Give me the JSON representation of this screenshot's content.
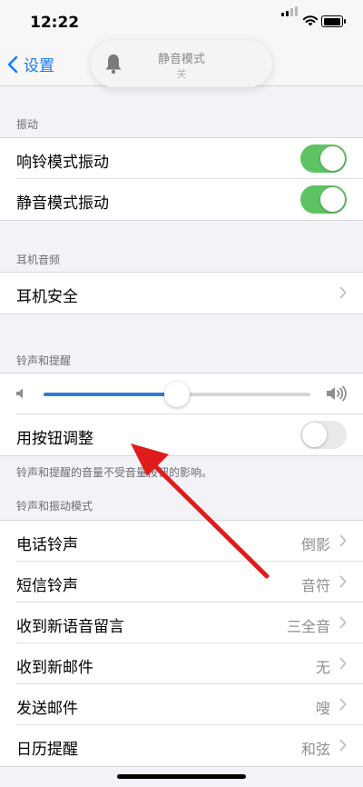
{
  "status_bar": {
    "time": "12:22"
  },
  "nav": {
    "back_label": "设置"
  },
  "banner": {
    "title": "静音模式",
    "subtitle": "关"
  },
  "sections": {
    "vibration": {
      "header": "振动",
      "rows": [
        {
          "label": "响铃模式振动",
          "toggle": "on"
        },
        {
          "label": "静音模式振动",
          "toggle": "on"
        }
      ]
    },
    "headphone": {
      "header": "耳机音频",
      "rows": [
        {
          "label": "耳机安全"
        }
      ]
    },
    "ringer": {
      "header": "铃声和提醒",
      "volume_level_fraction": 0.5,
      "change_with_buttons": {
        "label": "用按钮调整",
        "toggle": "off"
      },
      "footer": "铃声和提醒的音量不受音量按钮的影响。"
    },
    "sounds": {
      "header": "铃声和振动模式",
      "rows": [
        {
          "label": "电话铃声",
          "value": "倒影"
        },
        {
          "label": "短信铃声",
          "value": "音符"
        },
        {
          "label": "收到新语音留言",
          "value": "三全音"
        },
        {
          "label": "收到新邮件",
          "value": "无"
        },
        {
          "label": "发送邮件",
          "value": "嗖"
        },
        {
          "label": "日历提醒",
          "value": "和弦"
        }
      ]
    }
  },
  "colors": {
    "accent": "#1a7cf5",
    "toggle_on": "#5ec463",
    "slider_fill": "#2f7bd6",
    "annotation_arrow": "#e01b1b"
  }
}
